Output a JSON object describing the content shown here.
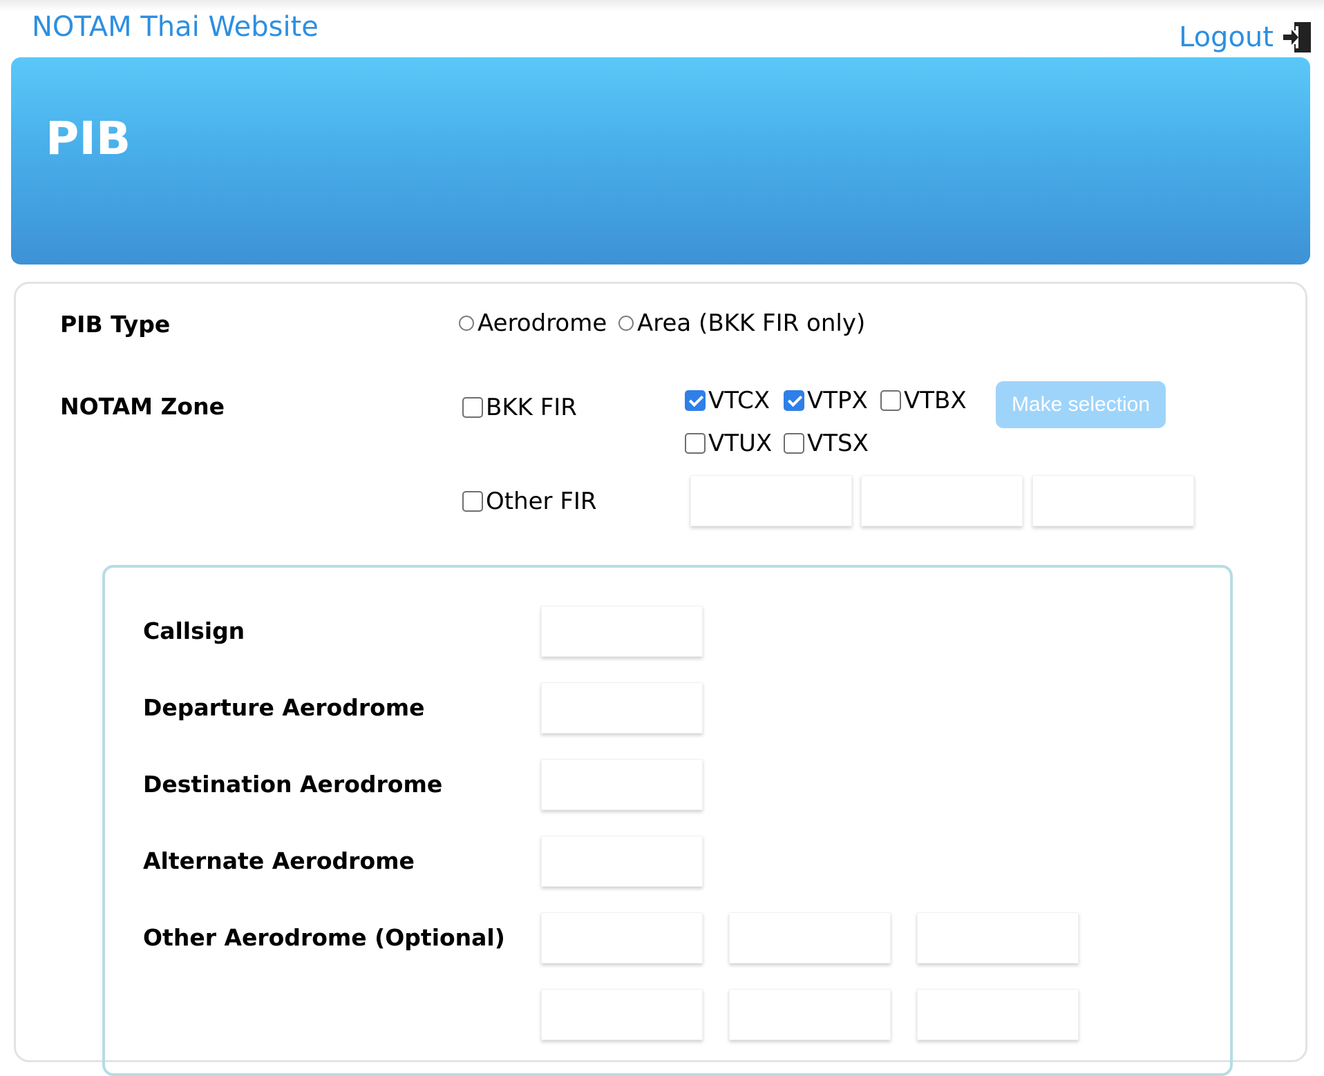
{
  "header": {
    "site_title": "NOTAM Thai Website",
    "logout_label": "Logout",
    "logout_icon": "exit-door-icon"
  },
  "banner": {
    "title": "PIB"
  },
  "form": {
    "pib_type": {
      "label": "PIB Type",
      "options": [
        {
          "label": "Aerodrome",
          "selected": false
        },
        {
          "label": "Area (BKK FIR only)",
          "selected": false
        }
      ]
    },
    "notam_zone": {
      "label": "NOTAM Zone",
      "bkk_fir": {
        "label": "BKK FIR",
        "checked": false
      },
      "zones": [
        {
          "label": "VTCX",
          "checked": true
        },
        {
          "label": "VTPX",
          "checked": true
        },
        {
          "label": "VTBX",
          "checked": false
        },
        {
          "label": "VTUX",
          "checked": false
        },
        {
          "label": "VTSX",
          "checked": false
        }
      ],
      "make_selection_label": "Make selection",
      "other_fir": {
        "label": "Other FIR",
        "checked": false
      },
      "other_fir_values": [
        "",
        "",
        ""
      ]
    },
    "flight": {
      "callsign_label": "Callsign",
      "callsign_value": "",
      "departure_label": "Departure Aerodrome",
      "departure_value": "",
      "destination_label": "Destination Aerodrome",
      "destination_value": "",
      "alternate_label": "Alternate Aerodrome",
      "alternate_value": "",
      "other_label": "Other Aerodrome (Optional)",
      "other_values": [
        "",
        "",
        "",
        "",
        "",
        ""
      ]
    }
  },
  "colors": {
    "link": "#2d8fe0",
    "banner_top": "#5bc8f8",
    "banner_bottom": "#3d92d6",
    "checkbox_checked": "#2f7fe8",
    "button": "#9fd4fa",
    "inner_border": "#b7dce5"
  }
}
